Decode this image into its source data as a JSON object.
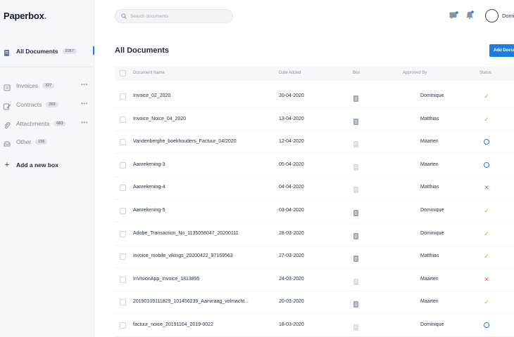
{
  "app": {
    "logo_text": "Paperbox",
    "logo_dot": "."
  },
  "sidebar": {
    "all_documents": {
      "label": "All Documents",
      "count": "2057"
    },
    "boxes": [
      {
        "label": "Invoices",
        "count": "327",
        "icon": "invoice-icon"
      },
      {
        "label": "Contracts",
        "count": "269",
        "icon": "contract-icon"
      },
      {
        "label": "Attachments",
        "count": "683",
        "icon": "attachment-icon"
      },
      {
        "label": "Other",
        "count": "156",
        "icon": "inbox-icon"
      }
    ],
    "more_label": "•••",
    "add_box_label": "Add a new box"
  },
  "header": {
    "search_placeholder": "Search documents",
    "user_name": "Dominique"
  },
  "main": {
    "title": "All Documents",
    "add_button_label": "Add Document",
    "columns": {
      "name": "Document Name",
      "date": "Date Added",
      "box": "Box",
      "approver": "Approved By",
      "status": "Status"
    },
    "rows": [
      {
        "name": "Invoice_02_2020",
        "date": "20-04-2020",
        "box": "invoice",
        "approver": "Dominique",
        "status": "approved"
      },
      {
        "name": "Invoice_Noice_04_2020",
        "date": "13-04-2020",
        "box": "invoice",
        "approver": "Matthias",
        "status": "approved"
      },
      {
        "name": "Vandenberghe_boekhouders_Factuur_04/2020",
        "date": "12-04-2020",
        "box": "other",
        "approver": "Maarten",
        "status": "pending"
      },
      {
        "name": "Aanrekening-3",
        "date": "05-04-2020",
        "box": "other",
        "approver": "Maarten",
        "status": "pending"
      },
      {
        "name": "Aanrekening-4",
        "date": "04-04-2020",
        "box": "other",
        "approver": "Matthias",
        "status": "rejected"
      },
      {
        "name": "Aanrekening-5",
        "date": "03-04-2020",
        "box": "invoice",
        "approver": "Dominique",
        "status": "approved"
      },
      {
        "name": "Adobe_Transaction_No_1135058047_20200111",
        "date": "28-03-2020",
        "box": "invoice",
        "approver": "Dominique",
        "status": "approved"
      },
      {
        "name": "invoice_mobile_vikings_20200422_97169563",
        "date": "27-03-2020",
        "box": "invoice",
        "approver": "Matthias",
        "status": "approved"
      },
      {
        "name": "InVisionApp_Invoice_1813895",
        "date": "24-03-2020",
        "box": "other",
        "approver": "Maarten",
        "status": "rejected"
      },
      {
        "name": "20190109111829_101456239_Aanvraag_volmacht...",
        "date": "20-03-2020",
        "box": "invoice",
        "approver": "Maarten",
        "status": "approved"
      },
      {
        "name": "factuur_noice_20191104_2019-0022",
        "date": "18-03-2020",
        "box": "other",
        "approver": "Dominique",
        "status": "pending"
      }
    ]
  },
  "colors": {
    "accent": "#1a7fe0",
    "approved": "#7ac943",
    "rejected": "#e85a5a",
    "pending": "#1a7fe0"
  }
}
